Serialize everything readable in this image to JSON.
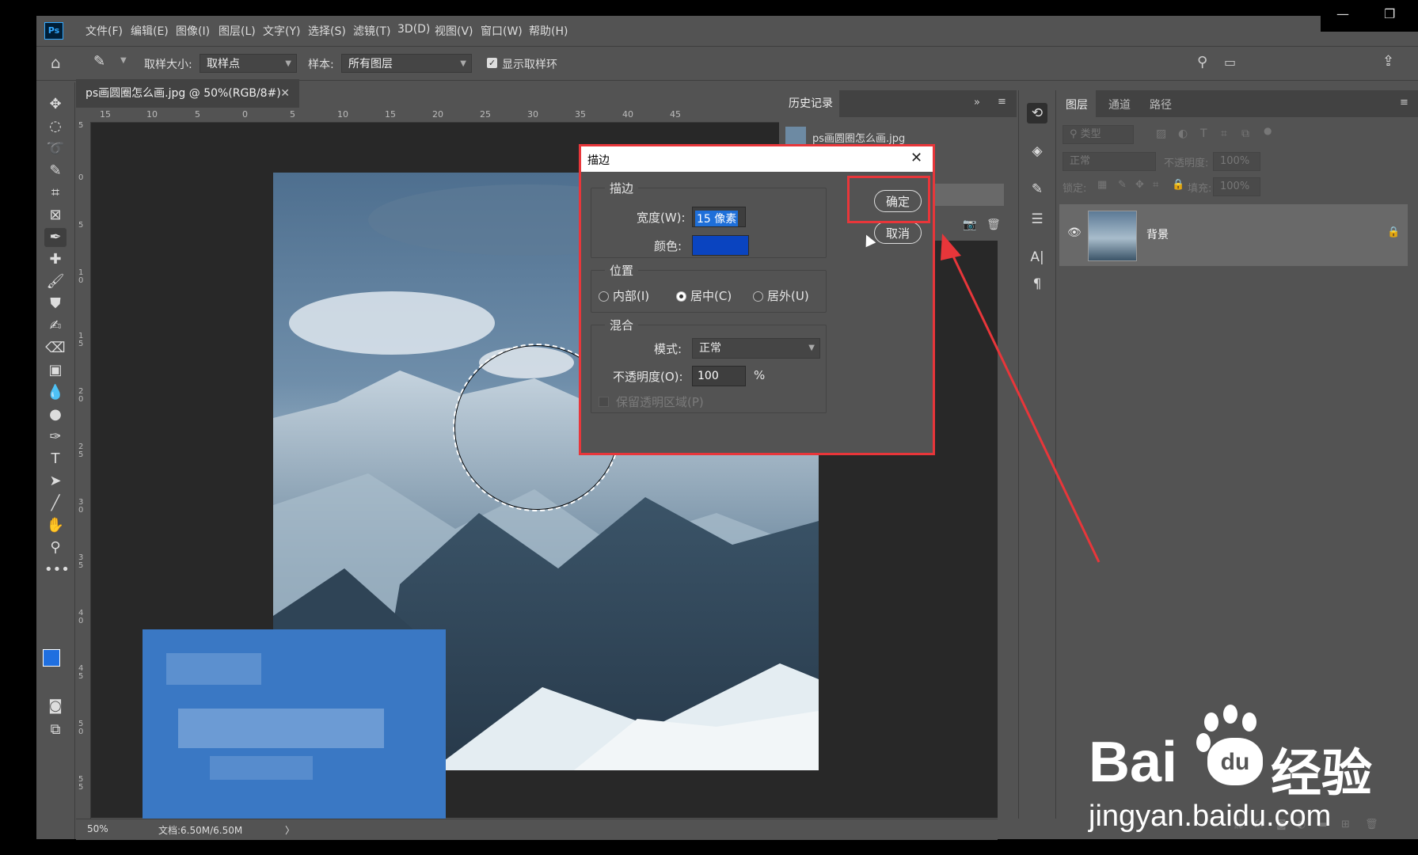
{
  "app": {
    "logo": "Ps",
    "menu": [
      "文件(F)",
      "编辑(E)",
      "图像(I)",
      "图层(L)",
      "文字(Y)",
      "选择(S)",
      "滤镜(T)",
      "3D(D)",
      "视图(V)",
      "窗口(W)",
      "帮助(H)"
    ]
  },
  "options": {
    "sample_size_label": "取样大小:",
    "sample_size_value": "取样点",
    "sample_label": "样本:",
    "sample_value": "所有图层",
    "show_ring_label": "显示取样环"
  },
  "document": {
    "tab_title": "ps画圆圈怎么画.jpg @ 50%(RGB/8#)",
    "ruler_h": [
      "15",
      "10",
      "5",
      "0",
      "5",
      "10",
      "15",
      "20",
      "25",
      "30",
      "35",
      "40",
      "45"
    ],
    "ruler_v": [
      "5",
      "0",
      "5",
      "1 0",
      "1 5",
      "2 0",
      "2 5",
      "3 0",
      "3 5",
      "4 0",
      "4 5",
      "5 0",
      "5 5"
    ],
    "zoom": "50%",
    "doc_info": "文档:6.50M/6.50M"
  },
  "history": {
    "tab_label": "历史记录",
    "item_label": "ps画圆圈怎么画.jpg"
  },
  "layers": {
    "tabs": [
      "图层",
      "通道",
      "路径"
    ],
    "filter_placeholder": "类型",
    "blend_mode": "正常",
    "opacity_label": "不透明度:",
    "opacity_value": "100%",
    "lock_label": "锁定:",
    "fill_label": "填充:",
    "fill_value": "100%",
    "layer_name": "背景"
  },
  "dialog": {
    "title": "描边",
    "stroke_group": "描边",
    "width_label": "宽度(W):",
    "width_value": "15 像素",
    "color_label": "颜色:",
    "color_value": "#0a44c0",
    "position_group": "位置",
    "pos_inside": "内部(I)",
    "pos_center": "居中(C)",
    "pos_outside": "居外(U)",
    "blend_group": "混合",
    "mode_label": "模式:",
    "mode_value": "正常",
    "opacity_label": "不透明度(O):",
    "opacity_value": "100",
    "opacity_unit": "%",
    "preserve_label": "保留透明区域(P)",
    "ok_label": "确定",
    "cancel_label": "取消"
  },
  "watermark": {
    "brand": "Bai",
    "brand_du": "du",
    "product": "经验",
    "url": "jingyan.baidu.com"
  },
  "colors": {
    "annotation_red": "#e8363a",
    "foreground": "#1f6fe0"
  }
}
